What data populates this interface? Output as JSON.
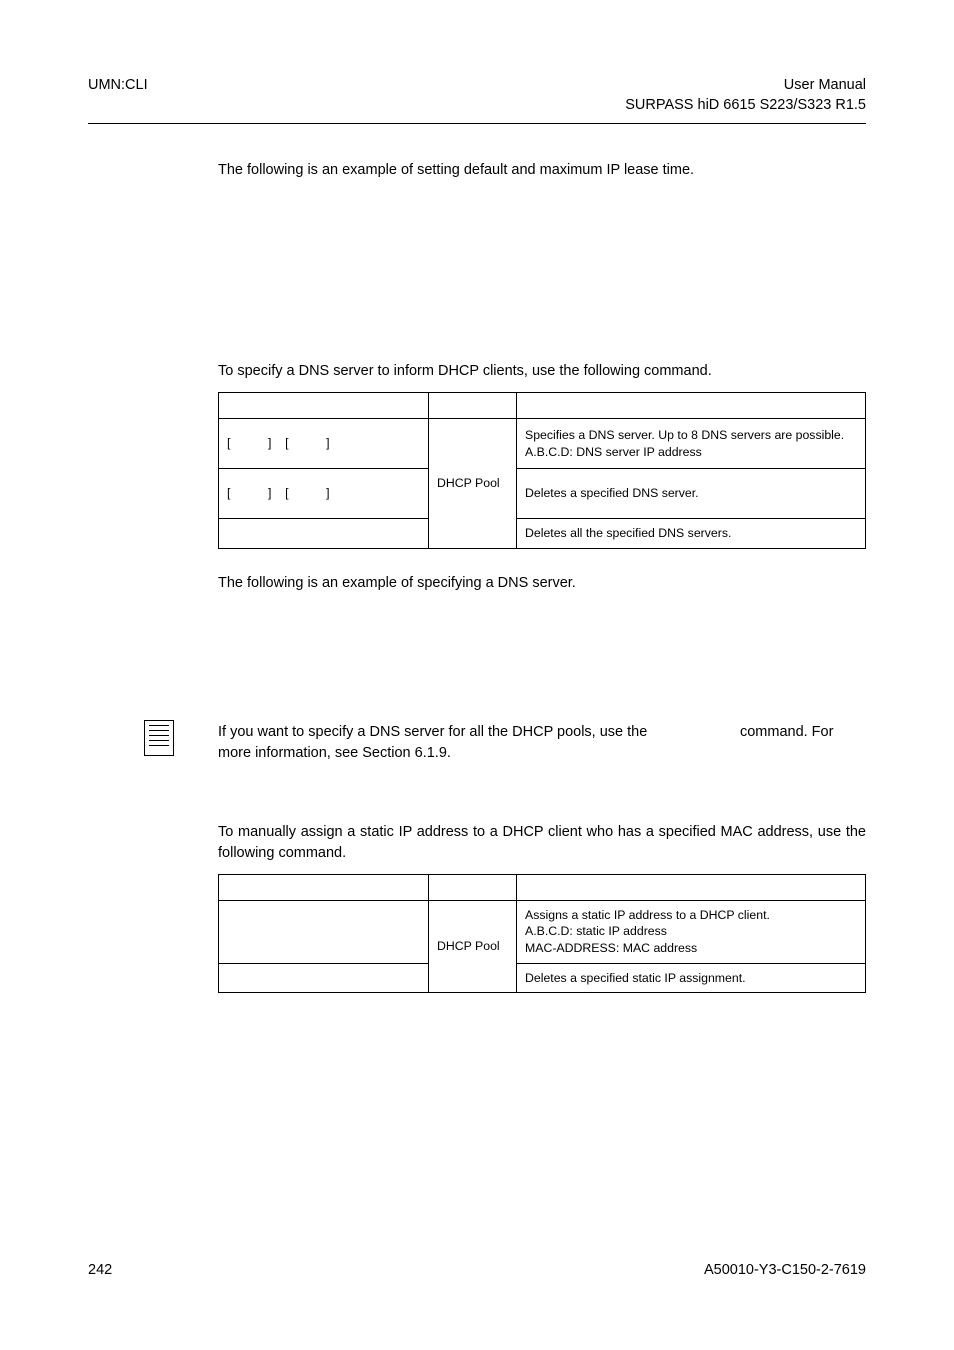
{
  "header": {
    "left": "UMN:CLI",
    "right_line1": "User  Manual",
    "right_line2": "SURPASS hiD 6615 S223/S323 R1.5"
  },
  "intro_lease": "The following is an example of setting default and maximum IP lease time.",
  "intro_dns": "To specify a DNS server to inform DHCP clients, use the following command.",
  "table1": {
    "c1_header": "",
    "c2_header": "",
    "c3_header": "",
    "mode": "DHCP Pool",
    "row1_cmd_pre": "[",
    "row1_cmd_mid1": "]",
    "row1_cmd_mid2": "[",
    "row1_cmd_post": "]",
    "row1_desc": "Specifies a DNS server. Up to 8 DNS servers are possible.\nA.B.C.D: DNS server IP address",
    "row2_cmd_pre": "[",
    "row2_cmd_mid1": "]",
    "row2_cmd_mid2": "[",
    "row2_cmd_post": "]",
    "row2_desc": "Deletes a specified DNS server.",
    "row3_cmd": "",
    "row3_desc": "Deletes all the specified DNS servers."
  },
  "after_t1": "The following is an example of specifying a DNS server.",
  "note_p1a": "If you want to specify a DNS server for all the DHCP pools, use the ",
  "note_p1b": " command. For more information, see Section 6.1.9.",
  "intro_static": "To manually assign a static IP address to a DHCP client who has a specified MAC address, use the following command.",
  "table2": {
    "mode": "DHCP Pool",
    "row1_cmd": "",
    "row1_desc": "Assigns a static IP address to a DHCP client.\nA.B.C.D: static IP address\nMAC-ADDRESS: MAC address",
    "row2_cmd": "",
    "row2_desc": "Deletes a specified static IP assignment."
  },
  "footer": {
    "left": "242",
    "right": "A50010-Y3-C150-2-7619"
  }
}
